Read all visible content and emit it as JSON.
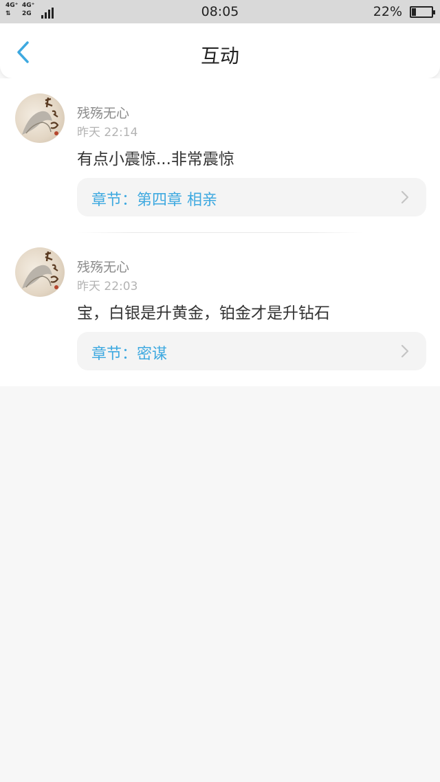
{
  "status_bar": {
    "net1": "4G⁺",
    "net2": "4G⁺",
    "net3": "2G",
    "time": "08:05",
    "battery": "22%",
    "battery_level": 0.22
  },
  "header": {
    "title": "互动",
    "back_icon": "chevron-left-icon",
    "accent_color": "#3ea9e0"
  },
  "items": [
    {
      "username": "残殇无心",
      "time": "昨天 22:14",
      "comment": "有点小震惊...非常震惊",
      "chapter": "章节：第四章 相亲"
    },
    {
      "username": "残殇无心",
      "time": "昨天 22:03",
      "comment": "宝，白银是升黄金，铂金才是升钻石",
      "chapter": "章节：密谋"
    }
  ]
}
